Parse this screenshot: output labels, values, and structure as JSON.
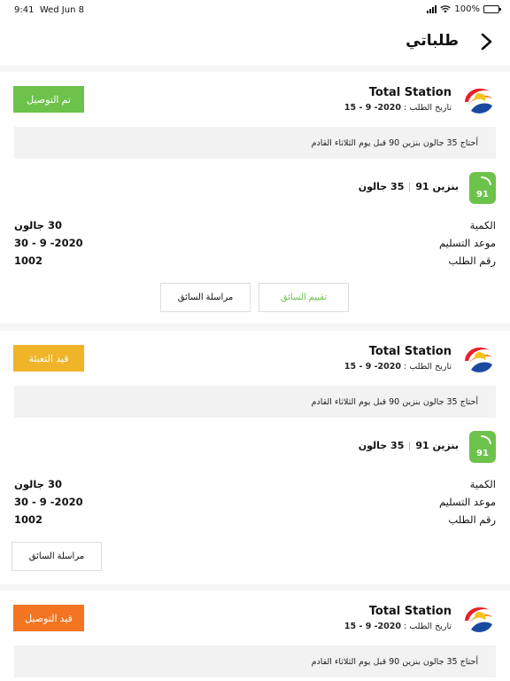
{
  "status_bar": {
    "time": "9:41",
    "date": "Wed Jun 8",
    "battery": "100%"
  },
  "header": {
    "title": "طلباتي"
  },
  "labels": {
    "order_date": "تاريخ الطلب :",
    "quantity": "الكمية",
    "delivery_date": "موعد التسليم",
    "order_number": "رقم الطلب"
  },
  "orders": [
    {
      "station": "Total Station",
      "order_date": "15 - 9 -2020",
      "status": "تم التوصيل",
      "status_color": "#6cc24a",
      "note": "أحتاج 35 جالون بنزين 90 قبل يوم الثلاثاء القادم",
      "fuel_badge": "91",
      "fuel_type": "بنزين 91",
      "fuel_amount": "35 جالون",
      "quantity": "30 جالون",
      "delivery_date": "30 - 9 -2020",
      "order_number": "1002",
      "rate_label": "تقييم السائق",
      "message_label": "مراسلة السائق"
    },
    {
      "station": "Total Station",
      "order_date": "15 - 9 -2020",
      "status": "قيد التعبئة",
      "status_color": "#f0b428",
      "note": "أحتاج 35 جالون بنزين 90 قبل يوم الثلاثاء القادم",
      "fuel_badge": "91",
      "fuel_type": "بنزين 91",
      "fuel_amount": "35 جالون",
      "quantity": "30 جالون",
      "delivery_date": "30 - 9 -2020",
      "order_number": "1002",
      "message_label": "مراسلة السائق"
    },
    {
      "station": "Total Station",
      "order_date": "15 - 9 -2020",
      "status": "قيد التوصيل",
      "status_color": "#f37521",
      "note": "أحتاج 35 جالون بنزين 90 قبل يوم الثلاثاء القادم"
    }
  ],
  "colors": {
    "green": "#6cc24a",
    "yellow": "#f0b428",
    "orange": "#f37521"
  },
  "icons": {
    "back": "chevron-right-icon",
    "logo": "total-station-logo",
    "fuel": "fuel-91-badge-icon",
    "signal": "signal-icon",
    "wifi": "wifi-icon",
    "battery": "battery-icon"
  }
}
